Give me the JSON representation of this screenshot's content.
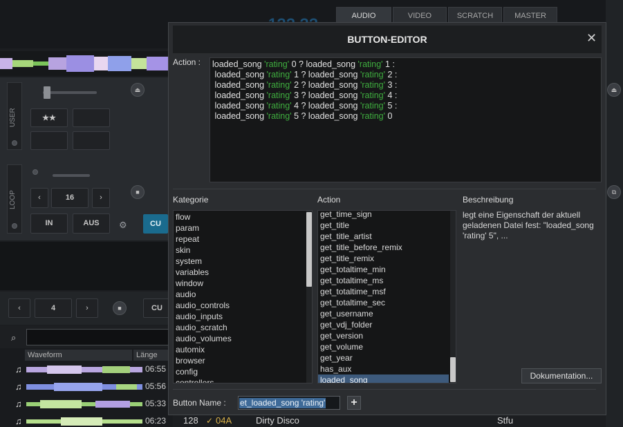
{
  "background": {
    "time_display": "1??.??",
    "top_tabs": [
      "AUDIO",
      "VIDEO",
      "SCRATCH",
      "MASTER"
    ],
    "deck": {
      "user_label": "USER",
      "loop_label": "LOOP",
      "stars": "★★",
      "loop_value": "16",
      "in_label": "IN",
      "out_label": "AUS",
      "cue_label": "CU"
    },
    "lower_deck": {
      "value": "4",
      "cue_label": "CU"
    },
    "browser": {
      "col_waveform": "Waveform",
      "col_length": "Länge",
      "rows": [
        {
          "length": "06:55"
        },
        {
          "length": "05:56"
        },
        {
          "length": "05:33"
        },
        {
          "length": "06:23",
          "bpm": "128",
          "key": "04A",
          "title": "Dirty Disco",
          "artist": "Stfu"
        }
      ]
    }
  },
  "dialog": {
    "title": "BUTTON-EDITOR",
    "action_label": "Action :",
    "action_lines": [
      [
        {
          "t": "loaded_song "
        },
        {
          "s": "'rating'"
        },
        {
          "t": " 0 ? loaded_song "
        },
        {
          "s": "'rating'"
        },
        {
          "t": " 1 :"
        }
      ],
      [
        {
          "t": " loaded_song "
        },
        {
          "s": "'rating'"
        },
        {
          "t": " 1 ? loaded_song "
        },
        {
          "s": "'rating'"
        },
        {
          "t": " 2 :"
        }
      ],
      [
        {
          "t": " loaded_song "
        },
        {
          "s": "'rating'"
        },
        {
          "t": " 2 ? loaded_song "
        },
        {
          "s": "'rating'"
        },
        {
          "t": " 3 :"
        }
      ],
      [
        {
          "t": " loaded_song "
        },
        {
          "s": "'rating'"
        },
        {
          "t": " 3 ? loaded_song "
        },
        {
          "s": "'rating'"
        },
        {
          "t": " 4 :"
        }
      ],
      [
        {
          "t": " loaded_song "
        },
        {
          "s": "'rating'"
        },
        {
          "t": " 4 ? loaded_song "
        },
        {
          "s": "'rating'"
        },
        {
          "t": " 5 :"
        }
      ],
      [
        {
          "t": " loaded_song "
        },
        {
          "s": "'rating'"
        },
        {
          "t": " 5 ? loaded_song "
        },
        {
          "s": "'rating'"
        },
        {
          "t": " 0"
        }
      ]
    ],
    "category_label": "Kategorie",
    "categories": [
      "flow",
      "param",
      "repeat",
      "skin",
      "system",
      "variables",
      "window",
      "audio",
      "audio_controls",
      "audio_inputs",
      "audio_scratch",
      "audio_volumes",
      "automix",
      "browser",
      "config",
      "controllers"
    ],
    "action_list_label": "Action",
    "actions": [
      "get_time_sign",
      "get_title",
      "get_title_artist",
      "get_title_before_remix",
      "get_title_remix",
      "get_totaltime_min",
      "get_totaltime_ms",
      "get_totaltime_msf",
      "get_totaltime_sec",
      "get_username",
      "get_vdj_folder",
      "get_version",
      "get_volume",
      "get_year",
      "has_aux",
      "loaded_song"
    ],
    "selected_action": "loaded_song",
    "description_label": "Beschreibung",
    "description": "legt eine Eigenschaft der aktuell geladenen Datei fest: \"loaded_song 'rating' 5\", ...",
    "doc_button": "Dokumentation...",
    "button_name_label": "Button Name :",
    "button_name_value": "et_loaded_song 'rating'",
    "add_button": "+"
  },
  "colors": {
    "string_literal": "#3fae3f",
    "selection": "#3d5a7c",
    "cue_accent": "#1a6b8e"
  }
}
